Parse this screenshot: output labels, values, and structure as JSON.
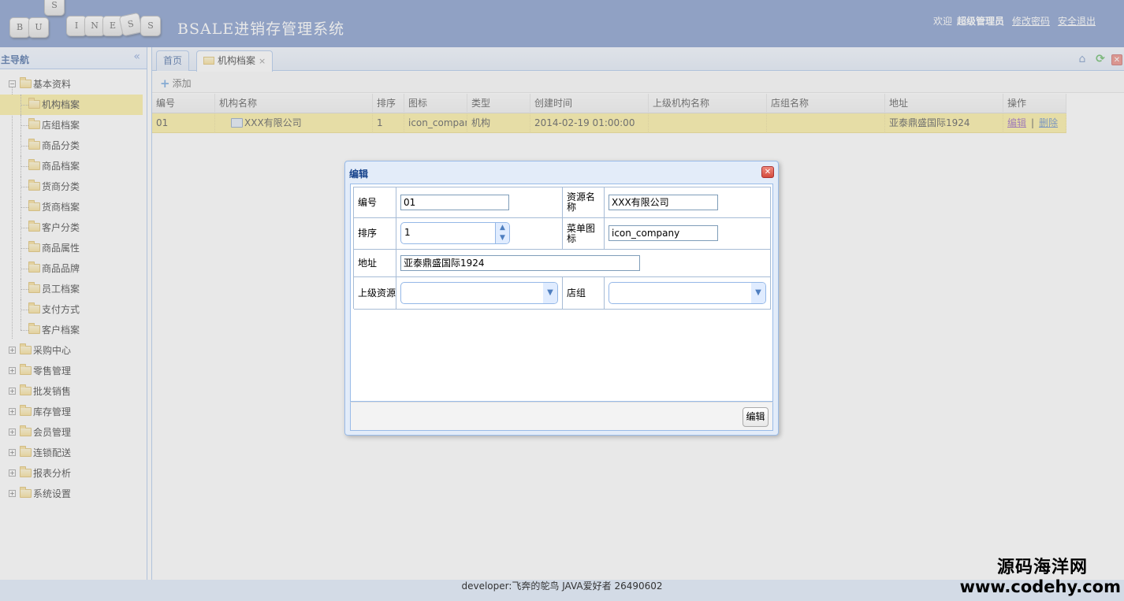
{
  "header": {
    "logo_letters": [
      "S",
      "B",
      "U",
      "I",
      "N",
      "E",
      "S",
      "S"
    ],
    "title": "BSALE进销存管理系统",
    "welcome": "欢迎",
    "user": "超级管理员",
    "change_password": "修改密码",
    "logout": "安全退出"
  },
  "sidebar": {
    "title": "主导航",
    "items": [
      {
        "label": "基本资料",
        "level": 0,
        "expanded": true
      },
      {
        "label": "机构档案",
        "level": 1,
        "selected": true
      },
      {
        "label": "店组档案",
        "level": 1
      },
      {
        "label": "商品分类",
        "level": 1
      },
      {
        "label": "商品档案",
        "level": 1
      },
      {
        "label": "货商分类",
        "level": 1
      },
      {
        "label": "货商档案",
        "level": 1
      },
      {
        "label": "客户分类",
        "level": 1
      },
      {
        "label": "商品属性",
        "level": 1
      },
      {
        "label": "商品品牌",
        "level": 1
      },
      {
        "label": "员工档案",
        "level": 1
      },
      {
        "label": "支付方式",
        "level": 1
      },
      {
        "label": "客户档案",
        "level": 1
      },
      {
        "label": "采购中心",
        "level": 0
      },
      {
        "label": "零售管理",
        "level": 0
      },
      {
        "label": "批发销售",
        "level": 0
      },
      {
        "label": "库存管理",
        "level": 0
      },
      {
        "label": "会员管理",
        "level": 0
      },
      {
        "label": "连锁配送",
        "level": 0
      },
      {
        "label": "报表分析",
        "level": 0
      },
      {
        "label": "系统设置",
        "level": 0
      }
    ]
  },
  "tabs": {
    "home": "首页",
    "active": "机构档案",
    "close": "×"
  },
  "toolbar": {
    "add": "添加"
  },
  "grid": {
    "columns": [
      "编号",
      "机构名称",
      "排序",
      "图标",
      "类型",
      "创建时间",
      "上级机构名称",
      "店组名称",
      "地址",
      "操作"
    ],
    "row": {
      "id": "01",
      "name": "XXX有限公司",
      "sort": "1",
      "icon": "icon_company",
      "type": "机构",
      "created": "2014-02-19 01:00:00",
      "parent": "",
      "store_group": "",
      "address": "亚泰鼎盛国际1924",
      "edit": "编辑",
      "sep": "|",
      "delete": "删除"
    }
  },
  "dialog": {
    "title": "编辑",
    "labels": {
      "id": "编号",
      "name": "资源名称",
      "sort": "排序",
      "menu_icon": "菜单图标",
      "address": "地址",
      "parent": "上级资源",
      "store_group": "店组"
    },
    "values": {
      "id": "01",
      "name": "XXX有限公司",
      "sort": "1",
      "menu_icon": "icon_company",
      "address": "亚泰鼎盛国际1924",
      "parent": "",
      "store_group": ""
    },
    "submit": "编辑"
  },
  "footer": {
    "text": "developer:飞奔的鸵鸟 JAVA爱好者 26490602"
  },
  "watermark": {
    "line1": "源码海洋网",
    "line2": "www.codehy.com"
  }
}
